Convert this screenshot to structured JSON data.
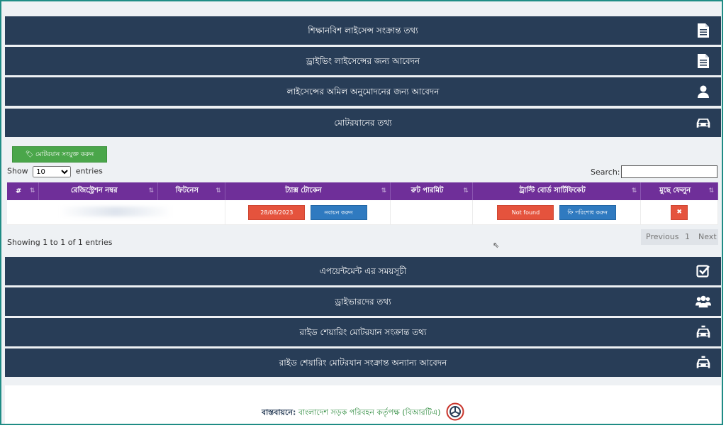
{
  "panels": {
    "learner_license": "শিক্ষানবিশ লাইসেন্স সংক্রান্ত তথ্য",
    "driving_license_apply": "ড্রাইভিং লাইসেন্সের জন্য আবেদন",
    "license_approval_apply": "লাইসেন্সের অমিল অনুমোদনের জন্য আবেদন",
    "vehicle_info": "মোটরযানের তথ্য",
    "appointment": "এপয়েন্টমেন্ট এর সময়সূচী",
    "driver_info": "ড্রাইভারদের তথ্য",
    "ride_sharing_info": "রাইড শেয়ারিং মোটরযান সংক্রান্ত তথ্য",
    "ride_sharing_other": "রাইড শেয়ারিং মোটরযান সংক্রান্ত অন্যান্য আবেদন"
  },
  "vehicle": {
    "add_button": "মোটরযান সংযুক্ত করুন",
    "show_label": "Show",
    "entries_label": "entries",
    "page_size": "10",
    "search_label": "Search:",
    "search_value": "",
    "columns": [
      "#",
      "রেজিস্ট্রেশন নম্বর",
      "ফিটনেস",
      "ট্যাক্স টোকেন",
      "রুট পারমিট",
      "ট্রাস্টি বোর্ড সার্টিফিকেট",
      "মুছে ফেলুন"
    ],
    "row": {
      "tax_date": "28/08/2023",
      "renew_button": "নবায়ন করুন",
      "certificate_status": "Not found",
      "fee_pay_button": "ফি পরিশোধ করুন",
      "delete_icon": "✖"
    },
    "info_text": "Showing 1 to 1 of 1 entries",
    "pager": {
      "previous": "Previous",
      "page": "1",
      "next": "Next"
    }
  },
  "footer": {
    "label": "বাস্তবায়নে:",
    "org": "বাংলাদেশ সড়ক পরিবহন কর্তৃপক্ষ (বিআরটিএ)"
  },
  "icons": [
    "document-icon",
    "document-icon",
    "user-icon",
    "car-icon",
    "checkbox-icon",
    "users-icon",
    "car-icon",
    "car-icon"
  ],
  "colors": {
    "bar": "#283d57",
    "header": "#6f2f99",
    "frame": "#1f8c85",
    "add_button": "#4aa64a",
    "danger": "#e5533d",
    "primary": "#2f7ac0"
  }
}
